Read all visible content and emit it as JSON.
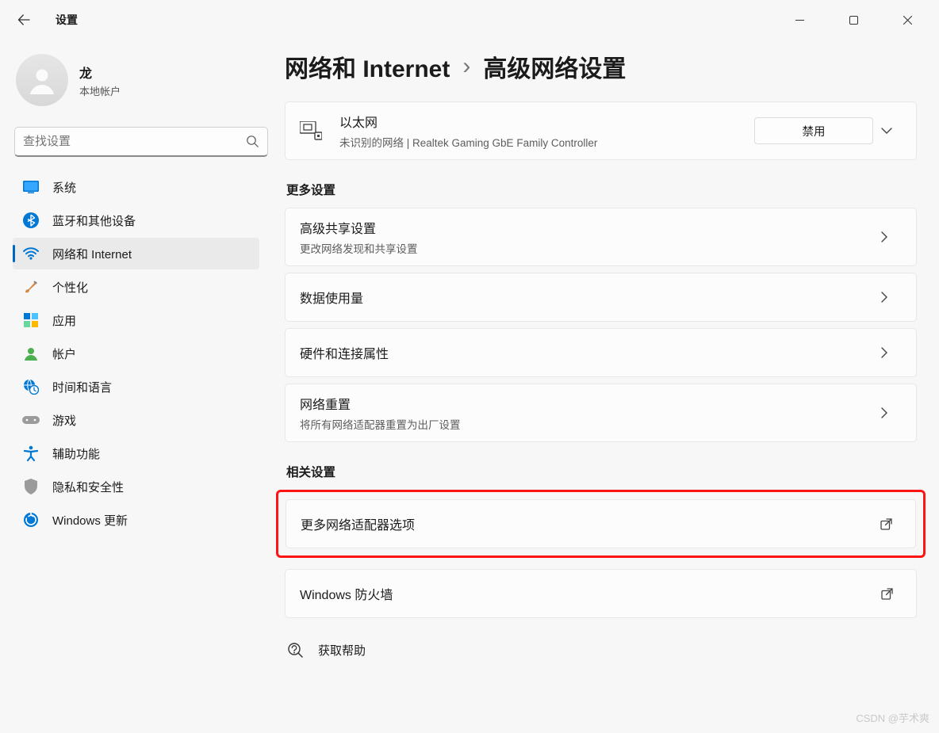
{
  "app_title": "设置",
  "window_controls": {
    "min": "min",
    "max": "max",
    "close": "close"
  },
  "profile": {
    "name": "龙",
    "subtitle": "本地帐户"
  },
  "search": {
    "placeholder": "查找设置"
  },
  "nav": {
    "items": [
      {
        "id": "system",
        "label": "系统"
      },
      {
        "id": "bluetooth",
        "label": "蓝牙和其他设备"
      },
      {
        "id": "network",
        "label": "网络和 Internet",
        "active": true
      },
      {
        "id": "personalize",
        "label": "个性化"
      },
      {
        "id": "apps",
        "label": "应用"
      },
      {
        "id": "accounts",
        "label": "帐户"
      },
      {
        "id": "timelang",
        "label": "时间和语言"
      },
      {
        "id": "gaming",
        "label": "游戏"
      },
      {
        "id": "accessibility",
        "label": "辅助功能"
      },
      {
        "id": "privacy",
        "label": "隐私和安全性"
      },
      {
        "id": "update",
        "label": "Windows 更新"
      }
    ]
  },
  "breadcrumb": {
    "parent": "网络和 Internet",
    "sep": "›",
    "current": "高级网络设置"
  },
  "adapter": {
    "title": "以太网",
    "subtitle": "未识别的网络 | Realtek Gaming GbE Family Controller",
    "disable_label": "禁用"
  },
  "sections": {
    "more_settings": {
      "title": "更多设置",
      "items": [
        {
          "id": "adv_sharing",
          "title": "高级共享设置",
          "subtitle": "更改网络发现和共享设置",
          "chev": true
        },
        {
          "id": "data_usage",
          "title": "数据使用量",
          "chev": true
        },
        {
          "id": "hw_conn",
          "title": "硬件和连接属性",
          "chev": true
        },
        {
          "id": "net_reset",
          "title": "网络重置",
          "subtitle": "将所有网络适配器重置为出厂设置",
          "chev": true
        }
      ]
    },
    "related": {
      "title": "相关设置",
      "items": [
        {
          "id": "more_adapters",
          "title": "更多网络适配器选项",
          "ext": true,
          "highlight": true
        },
        {
          "id": "firewall",
          "title": "Windows 防火墙",
          "ext": true
        }
      ]
    }
  },
  "help": {
    "label": "获取帮助"
  },
  "watermark": "CSDN @芋术爽"
}
